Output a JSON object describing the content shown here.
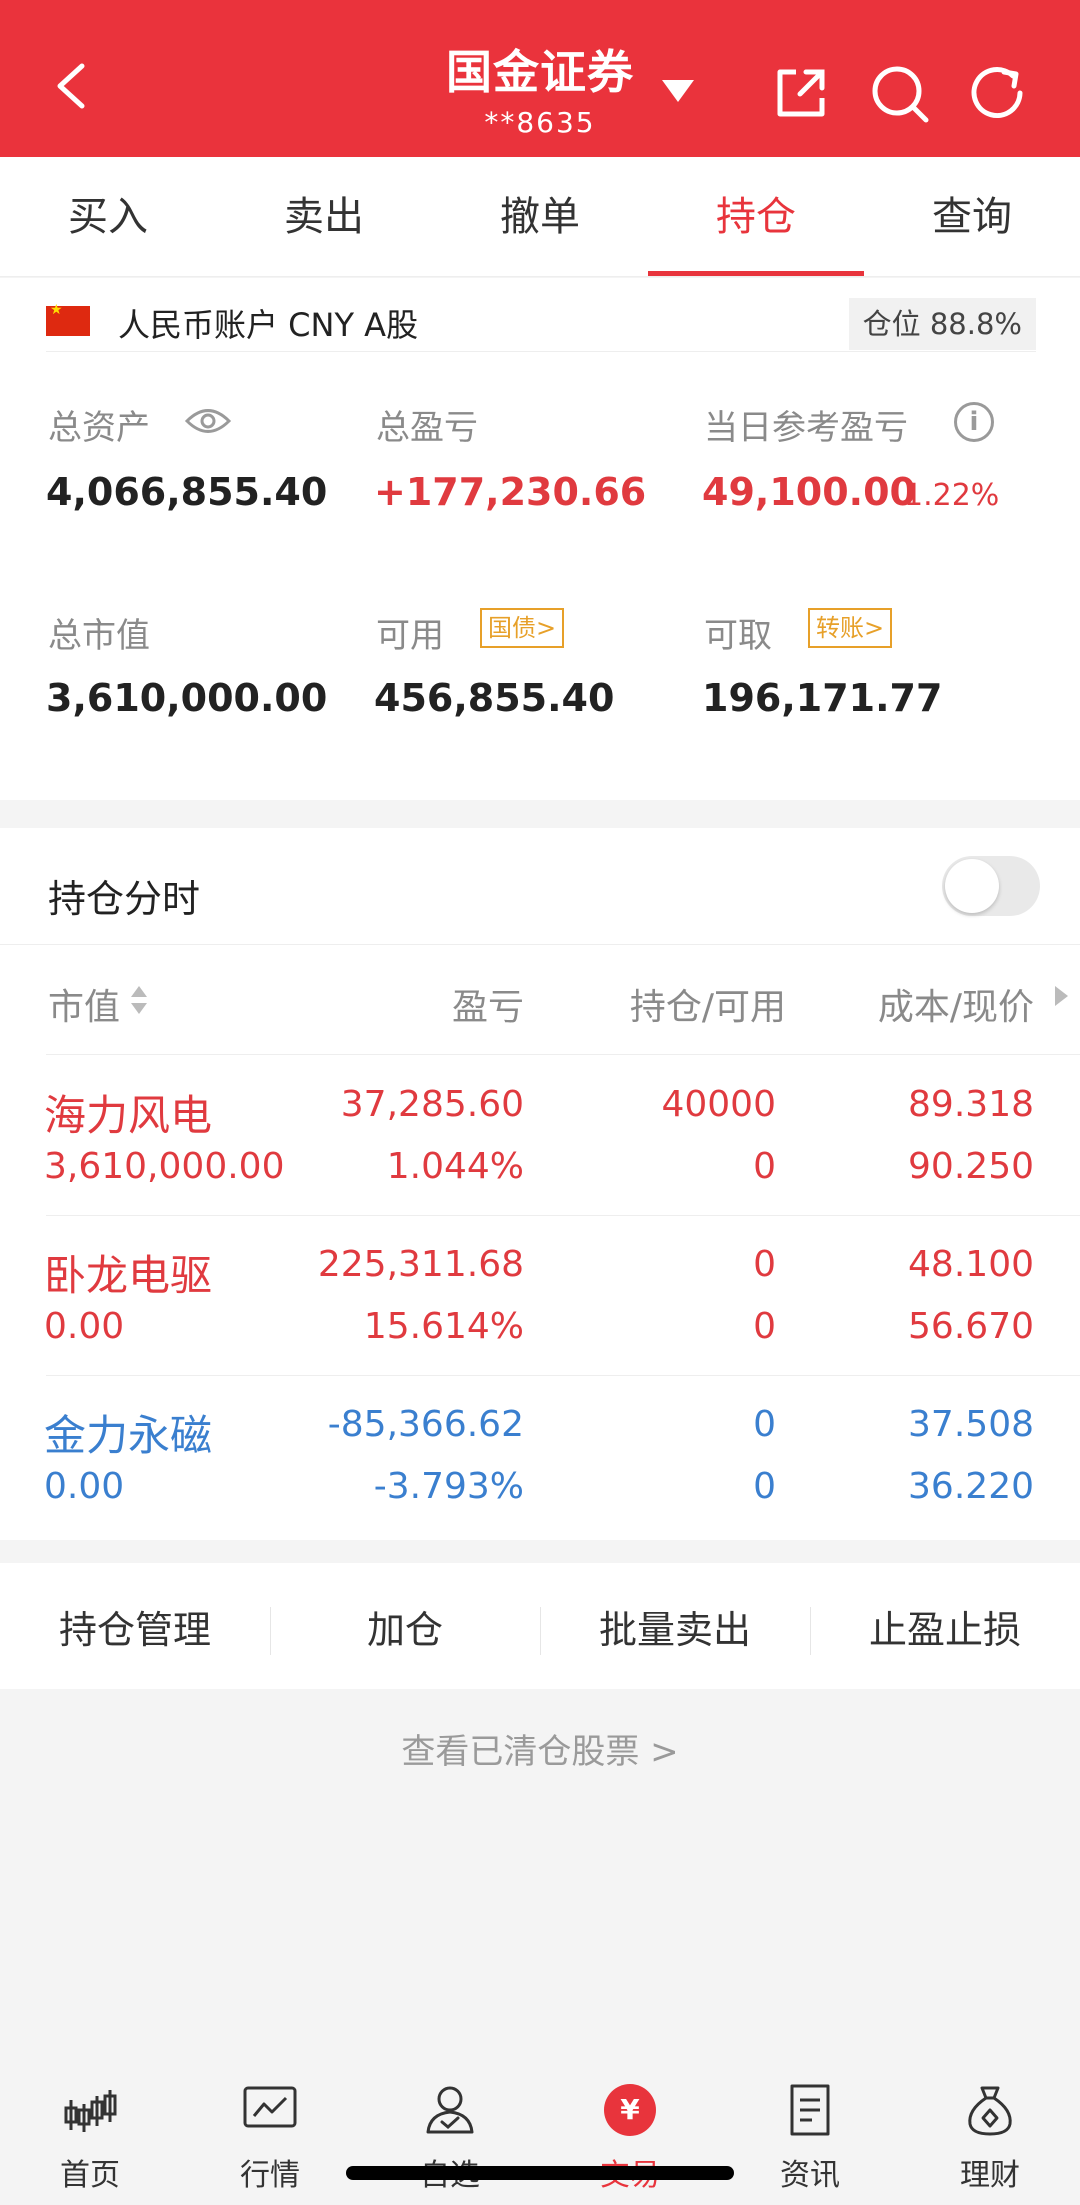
{
  "header": {
    "title": "国金证券",
    "account_masked": "**8635",
    "icons": [
      "back-icon",
      "dropdown-caret-icon",
      "share-icon",
      "search-icon",
      "refresh-icon"
    ],
    "bg_color": "#ea333c"
  },
  "tabs": [
    {
      "label": "买入",
      "active": false
    },
    {
      "label": "卖出",
      "active": false
    },
    {
      "label": "撤单",
      "active": false
    },
    {
      "label": "持仓",
      "active": true
    },
    {
      "label": "查询",
      "active": false
    }
  ],
  "account": {
    "label": "人民币账户 CNY A股",
    "position_label": "仓位 88.8%"
  },
  "summary": {
    "total_assets_label": "总资产",
    "total_assets": "4,066,855.40",
    "total_pnl_label": "总盈亏",
    "total_pnl": "+177,230.66",
    "daily_pnl_label": "当日参考盈亏",
    "daily_pnl": "49,100.00",
    "daily_pnl_pct": "1.22%",
    "market_value_label": "总市值",
    "market_value": "3,610,000.00",
    "available_label": "可用",
    "available": "456,855.40",
    "available_badge": "国债>",
    "withdrawable_label": "可取",
    "withdrawable": "196,171.77",
    "withdrawable_badge": "转账>"
  },
  "holdings": {
    "title": "持仓分时",
    "columns": [
      "市值",
      "盈亏",
      "持仓/可用",
      "成本/现价"
    ],
    "rows": [
      {
        "name": "海力风电",
        "market_value": "3,610,000.00",
        "pnl": "37,285.60",
        "pnl_pct": "1.044%",
        "holding": "40000",
        "available": "0",
        "cost": "89.318",
        "price": "90.250",
        "color": "red"
      },
      {
        "name": "卧龙电驱",
        "market_value": "0.00",
        "pnl": "225,311.68",
        "pnl_pct": "15.614%",
        "holding": "0",
        "available": "0",
        "cost": "48.100",
        "price": "56.670",
        "color": "red"
      },
      {
        "name": "金力永磁",
        "market_value": "0.00",
        "pnl": "-85,366.62",
        "pnl_pct": "-3.793%",
        "holding": "0",
        "available": "0",
        "cost": "37.508",
        "price": "36.220",
        "color": "blue"
      }
    ]
  },
  "actions": [
    "持仓管理",
    "加仓",
    "批量卖出",
    "止盈止损"
  ],
  "cleared_link": "查看已清仓股票 >",
  "nav": [
    {
      "label": "首页",
      "icon": "candlestick-icon"
    },
    {
      "label": "行情",
      "icon": "chart-icon"
    },
    {
      "label": "自选",
      "icon": "user-check-icon"
    },
    {
      "label": "交易",
      "icon": "yuan-icon",
      "active": true
    },
    {
      "label": "资讯",
      "icon": "document-icon"
    },
    {
      "label": "理财",
      "icon": "money-bag-icon"
    }
  ]
}
